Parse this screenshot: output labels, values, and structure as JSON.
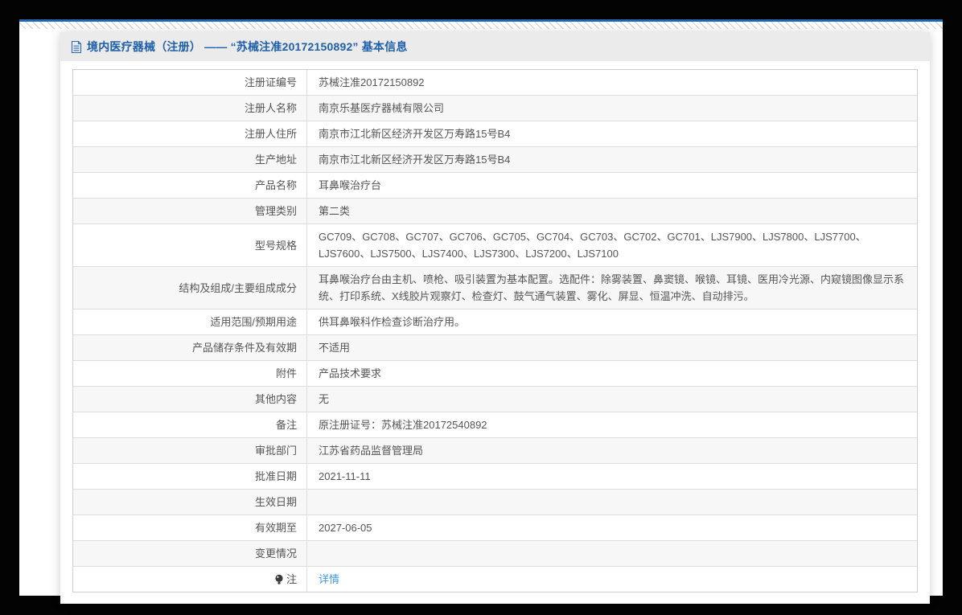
{
  "colors": {
    "frame": "#030304",
    "top_line": "#2166b1",
    "header_bg": "#ebebeb",
    "title_blue": "#1e5fa9",
    "link_blue": "#3e97e0",
    "text_gray": "#555555"
  },
  "header": {
    "icon": "document-icon",
    "title": "境内医疗器械（注册） —— “苏械注准20172150892” 基本信息"
  },
  "table": {
    "rows": [
      {
        "label": "注册证编号",
        "value": "苏械注准20172150892"
      },
      {
        "label": "注册人名称",
        "value": "南京乐基医疗器械有限公司"
      },
      {
        "label": "注册人住所",
        "value": "南京市江北新区经济开发区万寿路15号B4"
      },
      {
        "label": "生产地址",
        "value": "南京市江北新区经济开发区万寿路15号B4"
      },
      {
        "label": "产品名称",
        "value": "耳鼻喉治疗台"
      },
      {
        "label": "管理类别",
        "value": "第二类"
      },
      {
        "label": "型号规格",
        "value": "GC709、GC708、GC707、GC706、GC705、GC704、GC703、GC702、GC701、LJS7900、LJS7800、LJS7700、LJS7600、LJS7500、LJS7400、LJS7300、LJS7200、LJS7100"
      },
      {
        "label": "结构及组成/主要组成成分",
        "value": "耳鼻喉治疗台由主机、喷枪、吸引装置为基本配置。选配件：除雾装置、鼻窦镜、喉镜、耳镜、医用冷光源、内窥镜图像显示系统、打印系统、X线胶片观察灯、检查灯、鼓气通气装置、雾化、屏显、恒温冲洗、自动排污。"
      },
      {
        "label": "适用范围/预期用途",
        "value": "供耳鼻喉科作检查诊断治疗用。"
      },
      {
        "label": "产品储存条件及有效期",
        "value": "不适用"
      },
      {
        "label": "附件",
        "value": "产品技术要求"
      },
      {
        "label": "其他内容",
        "value": "无"
      },
      {
        "label": "备注",
        "value": "原注册证号：苏械注准20172540892"
      },
      {
        "label": "审批部门",
        "value": "江苏省药品监督管理局"
      },
      {
        "label": "批准日期",
        "value": "2021-11-11"
      },
      {
        "label": "生效日期",
        "value": ""
      },
      {
        "label": "有效期至",
        "value": "2027-06-05"
      },
      {
        "label": "变更情况",
        "value": ""
      },
      {
        "label": "注",
        "label_icon": "bulb-icon",
        "value": "详情",
        "value_is_link": true
      }
    ]
  }
}
